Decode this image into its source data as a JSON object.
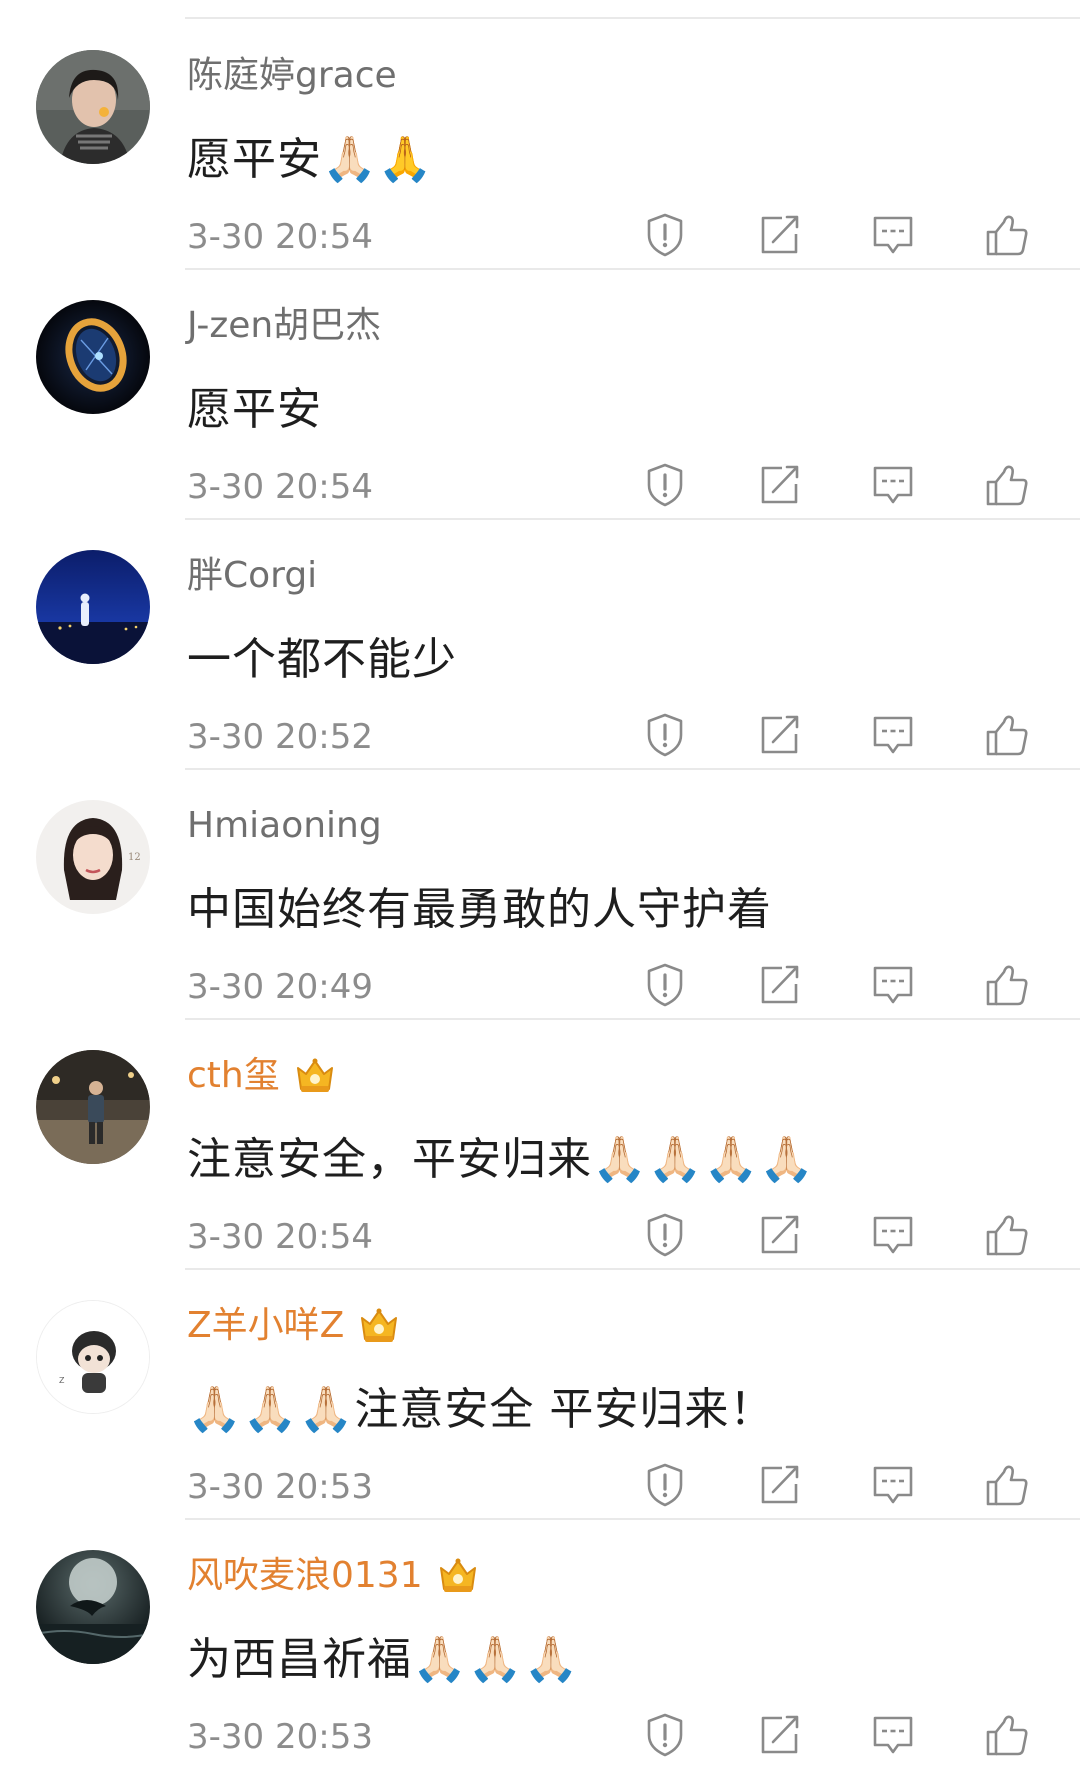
{
  "comments": [
    {
      "username": "陈庭婷grace",
      "vip": false,
      "text": "愿平安🙏🏻🙏",
      "time": "3-30 20:54",
      "avatar_icon": "avatar-girl-portrait"
    },
    {
      "username": "J-zen胡巴杰",
      "vip": false,
      "text": "愿平安",
      "time": "3-30 20:54",
      "avatar_icon": "avatar-glowing-ring"
    },
    {
      "username": "胖Corgi",
      "vip": false,
      "text": "一个都不能少",
      "time": "3-30 20:52",
      "avatar_icon": "avatar-night-scene"
    },
    {
      "username": "Hmiaoning",
      "vip": false,
      "text": "中国始终有最勇敢的人守护着",
      "time": "3-30 20:49",
      "avatar_icon": "avatar-girl-photo"
    },
    {
      "username": "cth玺",
      "vip": true,
      "text": "注意安全，平安归来🙏🏻🙏🏻🙏🏻🙏🏻",
      "time": "3-30 20:54",
      "avatar_icon": "avatar-street-man"
    },
    {
      "username": "Z羊小咩Z",
      "vip": true,
      "text": "🙏🏻🙏🏻🙏🏻注意安全 平安归来！",
      "time": "3-30 20:53",
      "avatar_icon": "avatar-cartoon"
    },
    {
      "username": "风吹麦浪0131",
      "vip": true,
      "text": "为西昌祈福🙏🏻🙏🏻🙏🏻",
      "time": "3-30 20:53",
      "avatar_icon": "avatar-dolphin-moon"
    }
  ],
  "actions": [
    "report-icon",
    "share-icon",
    "reply-icon",
    "like-icon"
  ],
  "colors": {
    "username": "#6f6f6f",
    "vip_username": "#e28130",
    "text": "#1e1e1e",
    "timestamp": "#8c8c8c",
    "divider": "#e9e9e9",
    "icon": "#8a8a8a"
  }
}
